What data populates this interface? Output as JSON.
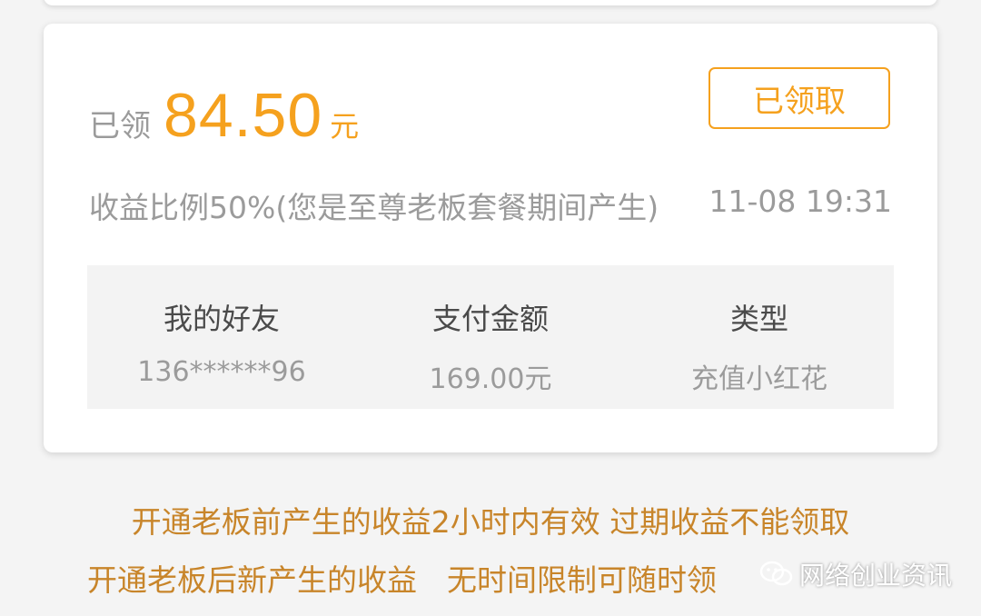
{
  "card": {
    "amount_prefix": "已领",
    "amount_value": "84.50",
    "amount_unit": "元",
    "claim_button_label": "已领取",
    "ratio_text": "收益比例50%(您是至尊老板套餐期间产生)",
    "datetime": "11-08 19:31",
    "details": {
      "friend_header": "我的好友",
      "friend_value": "136******96",
      "payment_header": "支付金额",
      "payment_value": "169.00元",
      "type_header": "类型",
      "type_value": "充值小红花"
    }
  },
  "notices": [
    "开通老板前产生的收益2小时内有效 过期收益不能领取",
    "开通老板后新产生的收益　无时间限制可随时领"
  ],
  "watermark": {
    "text": "网络创业资讯",
    "icon": "wechat-icon"
  },
  "colors": {
    "accent": "#f5a11e",
    "notice": "#c8852a",
    "muted_text": "#9b9b9b",
    "background": "#f4f4f4"
  }
}
